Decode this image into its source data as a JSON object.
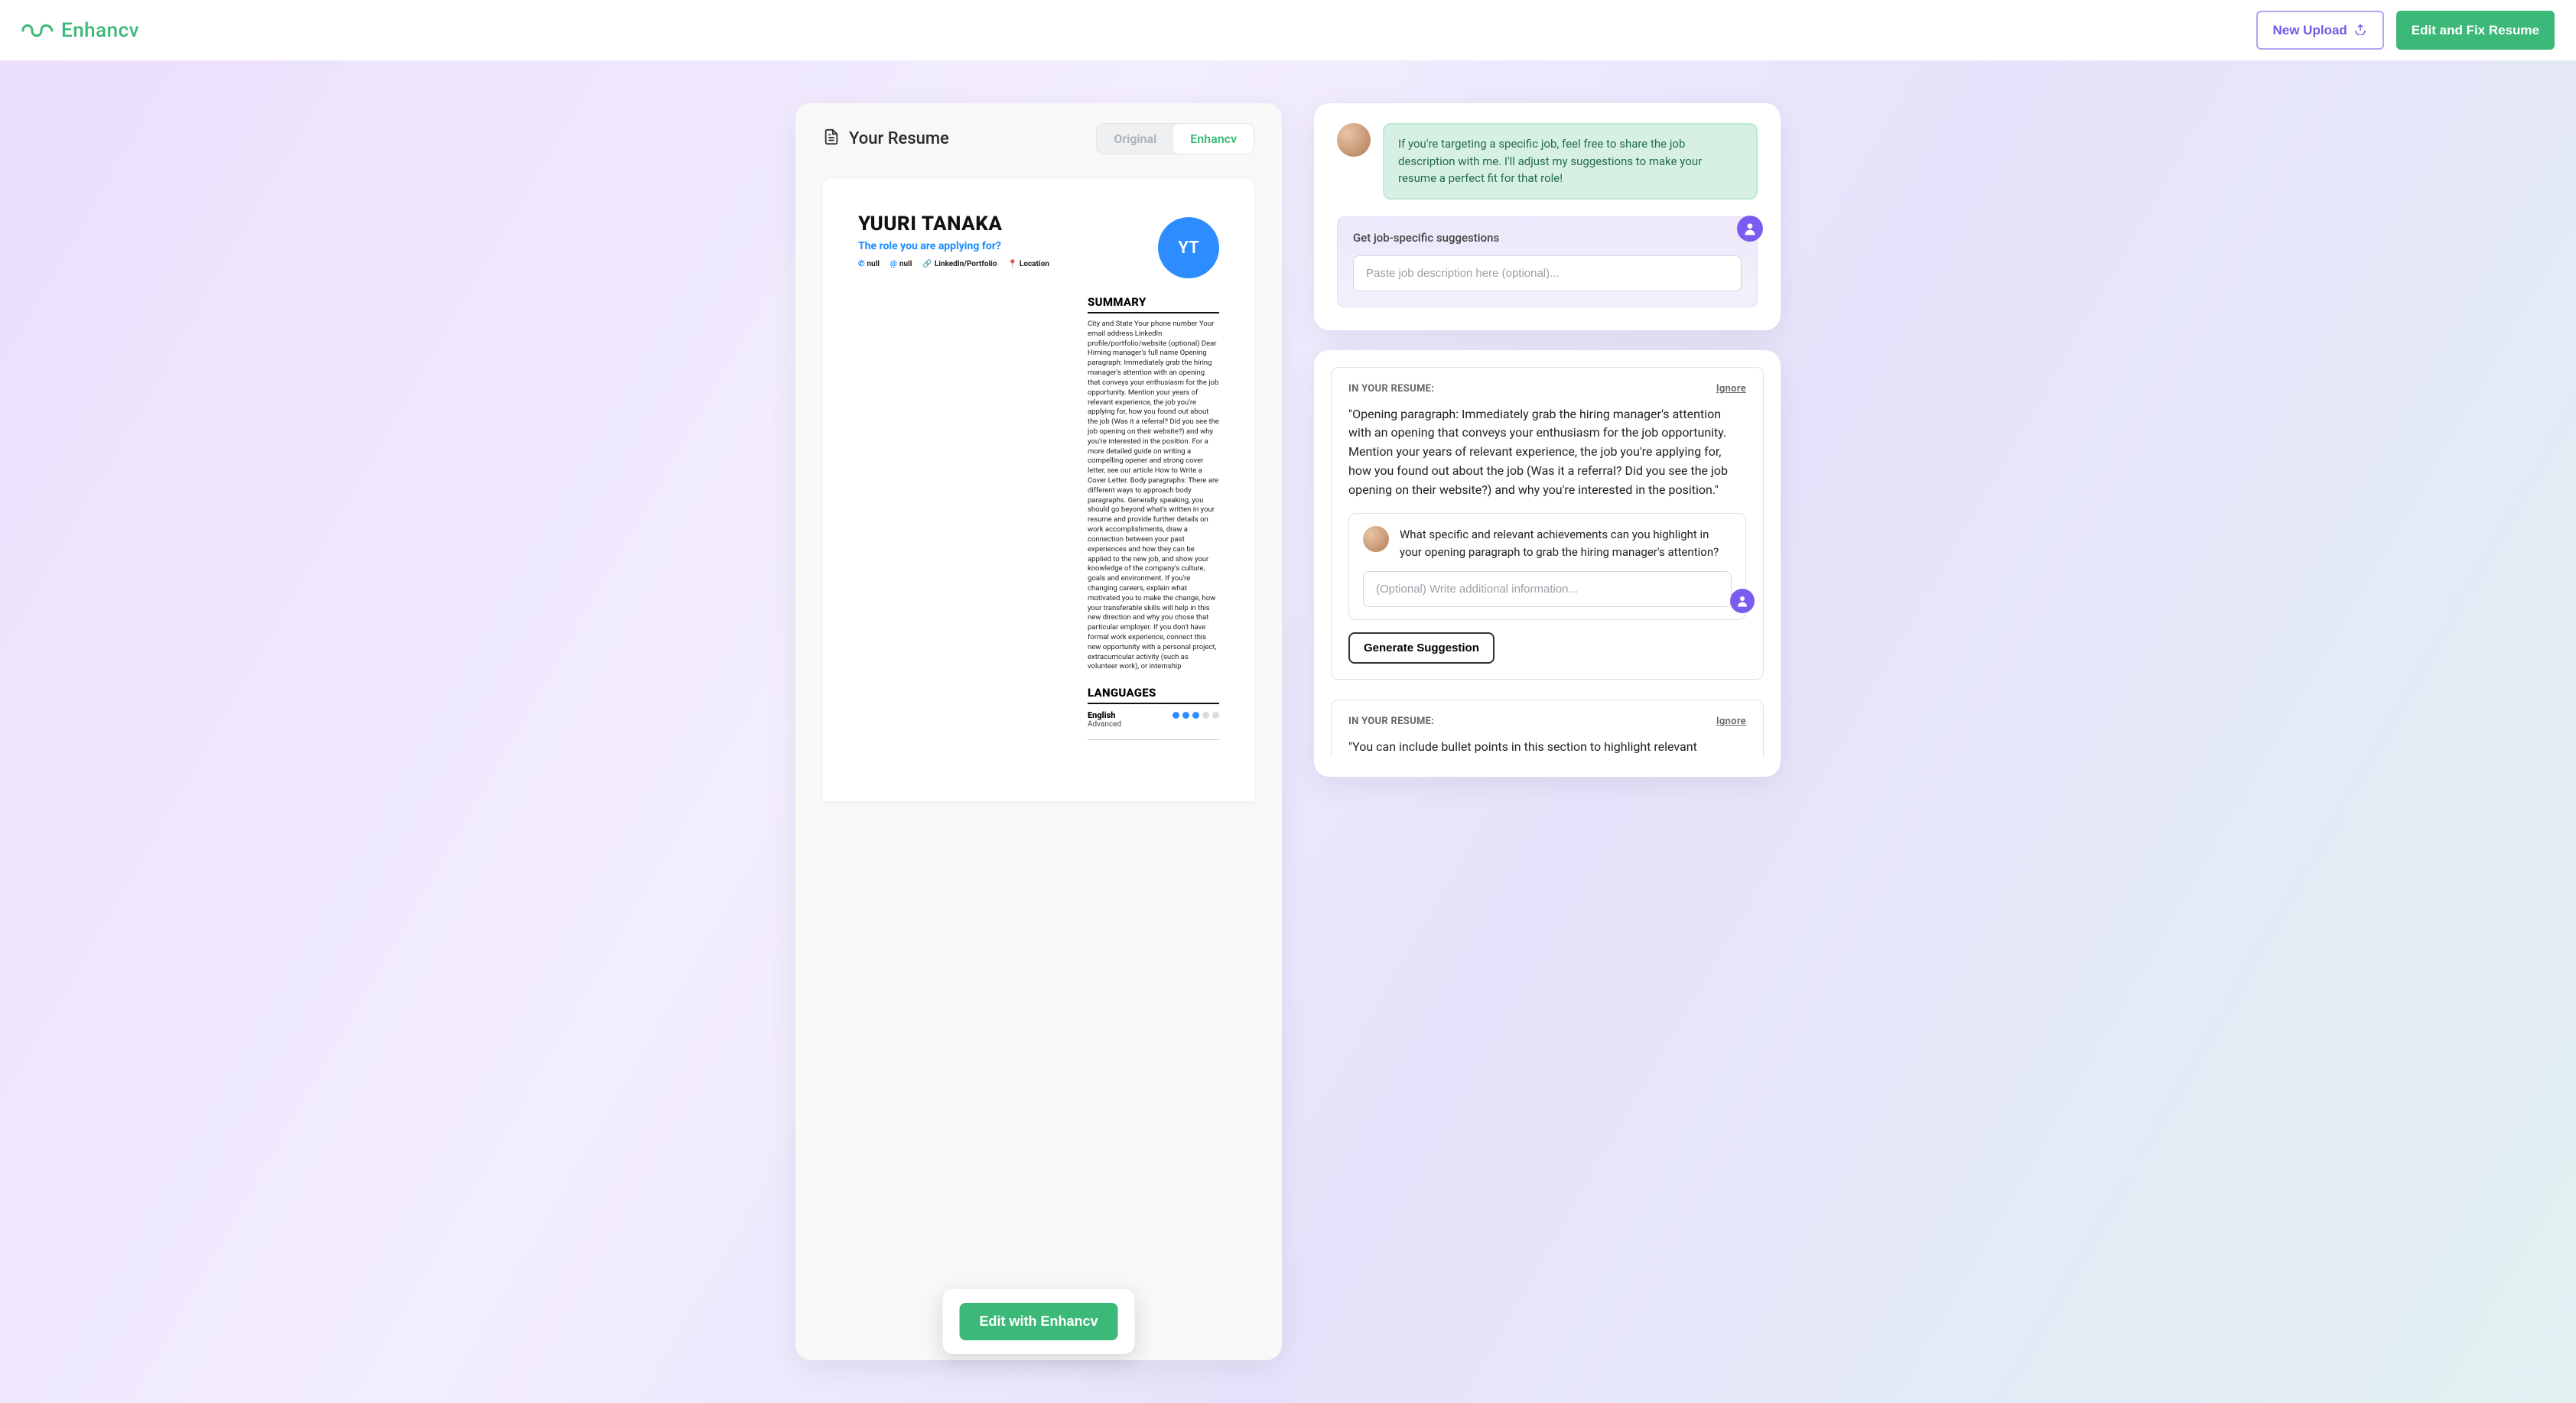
{
  "header": {
    "brand": "Enhancv",
    "new_upload": "New Upload",
    "edit_fix": "Edit and Fix Resume"
  },
  "left": {
    "title": "Your Resume",
    "tabs": {
      "original": "Original",
      "enhancv": "Enhancv"
    },
    "resume": {
      "name": "YUURI TANAKA",
      "role": "The role you are applying for?",
      "contacts": {
        "phone": "null",
        "email": "null",
        "linedin": "LinkedIn/Portfolio",
        "location": "Location"
      },
      "initials": "YT",
      "summary_title": "SUMMARY",
      "summary_text": "City and State Your phone number Your email address LinkedIn profile/portfolio/website (optional) Dear Hirning manager's full name Opening paragraph: Immediately grab the hiring manager's attention with an opening that conveys your enthusiasm for the job opportunity. Mention your years of relevant experience, the job you're applying for, how you found out about the job (Was it a referral? Did you see the job opening on their website?) and why you're interested in the position. For a more detailed guide on writing a compelling opener and strong cover letter, see our article How to Write a Cover Letter. Body paragraphs: There are different ways to approach body paragraphs. Generally speaking, you should go beyond what's written in your resume and provide further details on work accomplishments, draw a connection between your past experiences and how they can be applied to the new job, and show your knowledge of the company's culture, goals and environment. If you're changing careers, explain what motivated you to make the change, how your transferable skills will help in this new direction and why you chose that particular employer. If you don't have formal work experience, connect this new opportunity with a personal project, extracurricular activity (such as volunteer work), or internship",
      "languages_title": "LANGUAGES",
      "language": {
        "name": "English",
        "level": "Advanced",
        "dots_filled": 3,
        "dots_total": 5
      }
    },
    "edit_button": "Edit with Enhancv"
  },
  "right": {
    "assistant_message": "If you're targeting a specific job, feel free to share the job description with me. I'll adjust my suggestions to make your resume a perfect fit for that role!",
    "jobspec": {
      "title": "Get job-specific suggestions",
      "placeholder": "Paste job description here (optional)..."
    },
    "suggestions": [
      {
        "label": "IN YOUR RESUME:",
        "ignore": "Ignore",
        "quote": "\"Opening paragraph: Immediately grab the hiring manager's attention with an opening that conveys your enthusiasm for the job opportunity. Mention your years of relevant experience, the job you're applying for, how you found out about the job (Was it a referral? Did you see the job opening on their website?) and why you're interested in the position.\"",
        "question": "What specific and relevant achievements can you highlight in your opening paragraph to grab the hiring manager's attention?",
        "input_placeholder": "(Optional) Write additional information...",
        "generate": "Generate Suggestion"
      },
      {
        "label": "IN YOUR RESUME:",
        "ignore": "Ignore",
        "quote": "\"You can include bullet points in this section to highlight relevant"
      }
    ]
  }
}
